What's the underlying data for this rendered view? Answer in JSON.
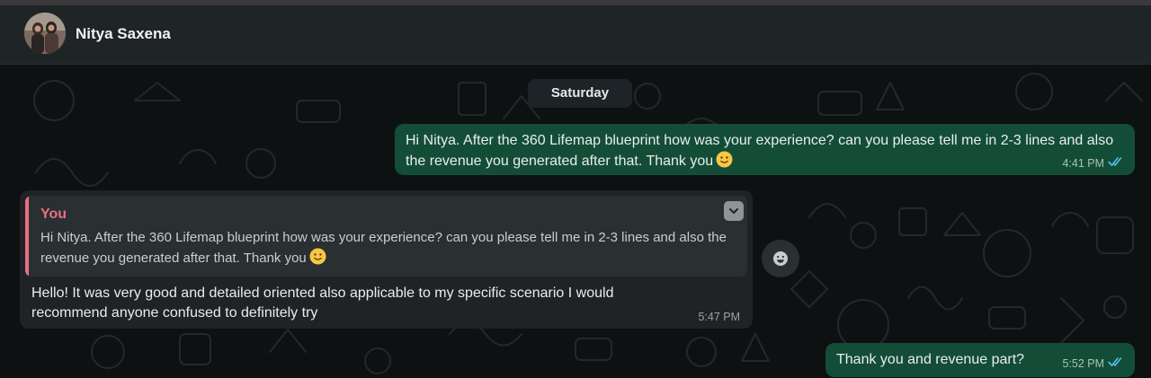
{
  "header": {
    "contact_name": "Nitya Saxena",
    "avatar_icon": "contact-photo"
  },
  "chat": {
    "day_divider": "Saturday",
    "messages": [
      {
        "direction": "outgoing",
        "text": "Hi Nitya. After the 360 Lifemap blueprint how was your experience? can you please tell me in 2-3 lines and also the revenue you generated after that. Thank you",
        "emoji": "slightly-smiling-face",
        "time": "4:41 PM",
        "status_icon": "double-check-read-icon"
      },
      {
        "direction": "incoming",
        "reply_to": {
          "author": "You",
          "text": "Hi Nitya. After the 360 Lifemap blueprint how was your experience? can you please tell me in 2-3 lines and also the revenue you generated after that. Thank you",
          "emoji": "slightly-smiling-face"
        },
        "text": "Hello! It was very good and detailed oriented also applicable to my specific scenario I would recommend anyone confused to definitely try",
        "time": "5:47 PM",
        "menu_icon": "chevron-down-icon",
        "reaction_icon": "emoji-icon"
      },
      {
        "direction": "outgoing",
        "text": "Thank you and revenue part?",
        "time": "5:52 PM",
        "status_icon": "double-check-read-icon"
      }
    ]
  },
  "colors": {
    "header_bg": "#1f2427",
    "chat_bg": "#0e1112",
    "outgoing_bubble": "#134d37",
    "incoming_bubble": "#1f2326",
    "quote_accent": "#e86f83",
    "read_check": "#53bdeb"
  }
}
